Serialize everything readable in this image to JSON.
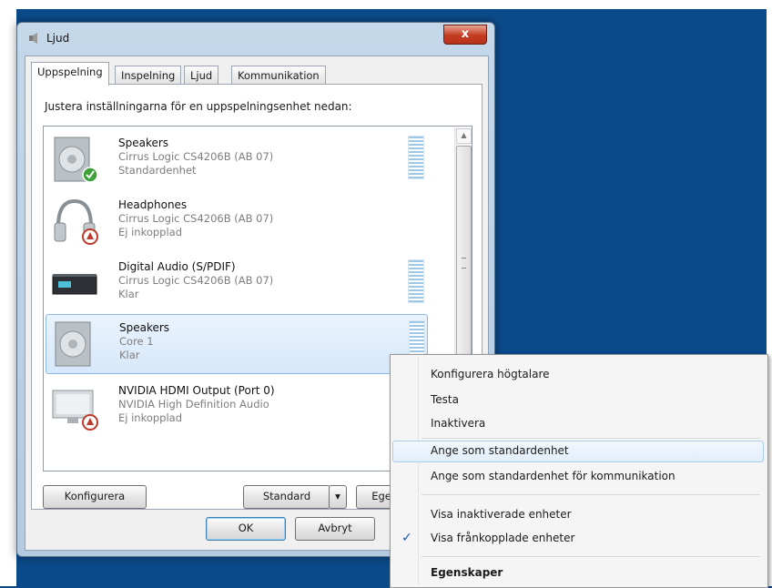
{
  "window": {
    "title": "Ljud",
    "close_label": "x",
    "tabs": [
      {
        "label": "Uppspelning",
        "active": true
      },
      {
        "label": "Inspelning",
        "active": false
      },
      {
        "label": "Ljud",
        "active": false
      },
      {
        "label": "Kommunikation",
        "active": false
      }
    ],
    "instruction": "Justera inställningarna för en uppspelningsenhet nedan:",
    "devices": [
      {
        "name": "Speakers",
        "driver": "Cirrus Logic CS4206B (AB 07)",
        "status": "Standardenhet",
        "icon": "speaker-icon",
        "badge": "green-check"
      },
      {
        "name": "Headphones",
        "driver": "Cirrus Logic CS4206B (AB 07)",
        "status": "Ej inkopplad",
        "icon": "headphones-icon",
        "badge": "red-down"
      },
      {
        "name": "Digital Audio (S/PDIF)",
        "driver": "Cirrus Logic CS4206B (AB 07)",
        "status": "Klar",
        "icon": "digital-audio-icon",
        "badge": ""
      },
      {
        "name": "Speakers",
        "driver": "Core 1",
        "status": "Klar",
        "icon": "speaker-icon",
        "badge": ""
      },
      {
        "name": "NVIDIA HDMI Output (Port 0)",
        "driver": "NVIDIA High Definition Audio",
        "status": "Ej inkopplad",
        "icon": "monitor-icon",
        "badge": "red-down"
      }
    ],
    "buttons": {
      "configure": "Konfigurera",
      "standard": "Standard",
      "standard_arrow": "▾",
      "properties": "Egenskaper",
      "ok": "OK",
      "cancel": "Avbryt"
    }
  },
  "context_menu": {
    "items": [
      {
        "label": "Konfigurera högtalare"
      },
      {
        "label": "Testa"
      },
      {
        "label": "Inaktivera"
      },
      {
        "label": "Ange som standardenhet",
        "highlighted": true
      },
      {
        "label": "Ange som standardenhet för kommunikation"
      },
      {
        "label": "Visa inaktiverade enheter"
      },
      {
        "label": "Visa frånkopplade enheter",
        "checked": true
      },
      {
        "label": "Egenskaper"
      }
    ],
    "check_glyph": "✓"
  },
  "colors": {
    "desktop": "#0b4a8a",
    "selection": "#d6e8fb",
    "accent": "#1c57b5"
  }
}
